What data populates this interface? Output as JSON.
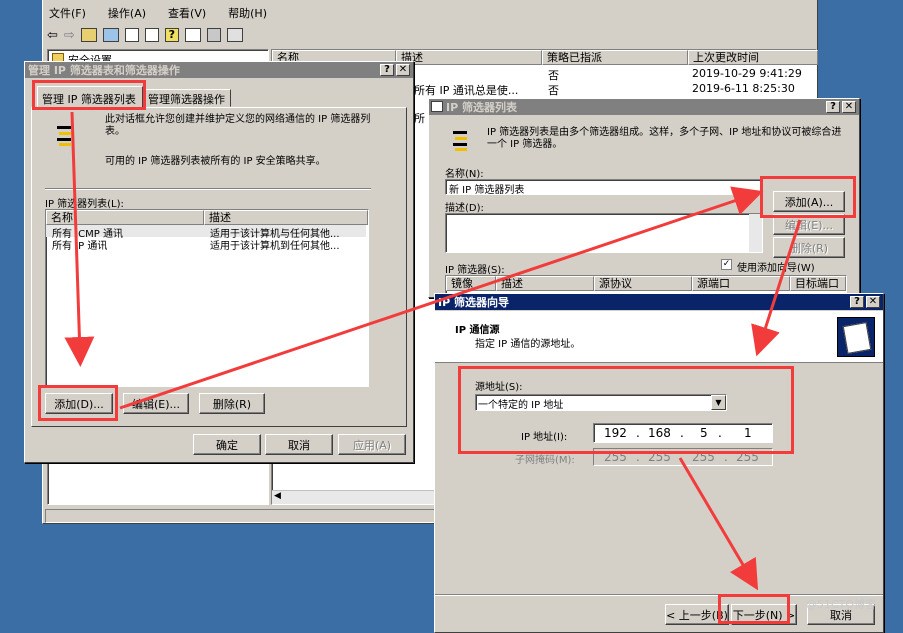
{
  "mmc": {
    "menu": [
      "文件(F)",
      "操作(A)",
      "查看(V)",
      "帮助(H)"
    ],
    "tree_item": "安全设置",
    "columns": [
      "名称",
      "描述",
      "策略已指派",
      "上次更改时间"
    ],
    "rows": [
      {
        "desc": "",
        "assigned": "否",
        "time": "2019-10-29 9:41:29"
      },
      {
        "desc": "所有 IP 通讯总是使...",
        "assigned": "否",
        "time": "2019-6-11 8:25:30"
      },
      {
        "desc": "所",
        "assigned": "",
        "time": ""
      }
    ]
  },
  "manage": {
    "title": "管理 IP 筛选器表和筛选器操作",
    "tabs": [
      "管理 IP 筛选器列表",
      "管理筛选器操作"
    ],
    "desc1": "此对话框允许您创建并维护定义您的网络通信的 IP 筛选器列表。",
    "desc2": "可用的 IP 筛选器列表被所有的 IP 安全策略共享。",
    "list_label": "IP 筛选器列表(L):",
    "columns": [
      "名称",
      "描述"
    ],
    "rows": [
      {
        "name": "所有 ICMP 通讯",
        "desc": "适用于该计算机与任何其他..."
      },
      {
        "name": "所有 IP 通讯",
        "desc": "适用于该计算机到任何其他..."
      }
    ],
    "btn_add": "添加(D)...",
    "btn_edit": "编辑(E)...",
    "btn_remove": "删除(R)",
    "btn_ok": "确定",
    "btn_cancel": "取消",
    "btn_apply": "应用(A)"
  },
  "filterlist": {
    "title": "IP 筛选器列表",
    "desc": "IP 筛选器列表是由多个筛选器组成。这样，多个子网、IP 地址和协议可被综合进一个 IP 筛选器。",
    "name_label": "名称(N):",
    "name_value": "新 IP 筛选器列表",
    "desc_label": "描述(D):",
    "btn_add": "添加(A)...",
    "btn_edit": "编辑(E)...",
    "btn_remove": "删除(R)",
    "filters_label": "IP 筛选器(S):",
    "use_wizard": "使用添加向导(W)",
    "columns": [
      "镜像",
      "描述",
      "源协议",
      "源端口",
      "目标端口"
    ]
  },
  "wizard": {
    "title": "IP 筛选器向导",
    "heading": "IP 通信源",
    "subheading": "指定 IP 通信的源地址。",
    "source_label": "源地址(S):",
    "source_value": "一个特定的 IP 地址",
    "ip_label": "IP 地址(I):",
    "ip": [
      "192",
      "168",
      "5",
      "1"
    ],
    "mask_label": "子网掩码(M):",
    "mask": [
      "255",
      "255",
      "255",
      "255"
    ],
    "btn_back": "< 上一步(B)",
    "btn_next": "下一步(N) >",
    "btn_cancel": "取消"
  },
  "watermark": "@51CTO博客",
  "colors": {
    "desktop": "#3a6ea5",
    "highlight": "#f23c3c",
    "title_active": "#0a246a"
  }
}
